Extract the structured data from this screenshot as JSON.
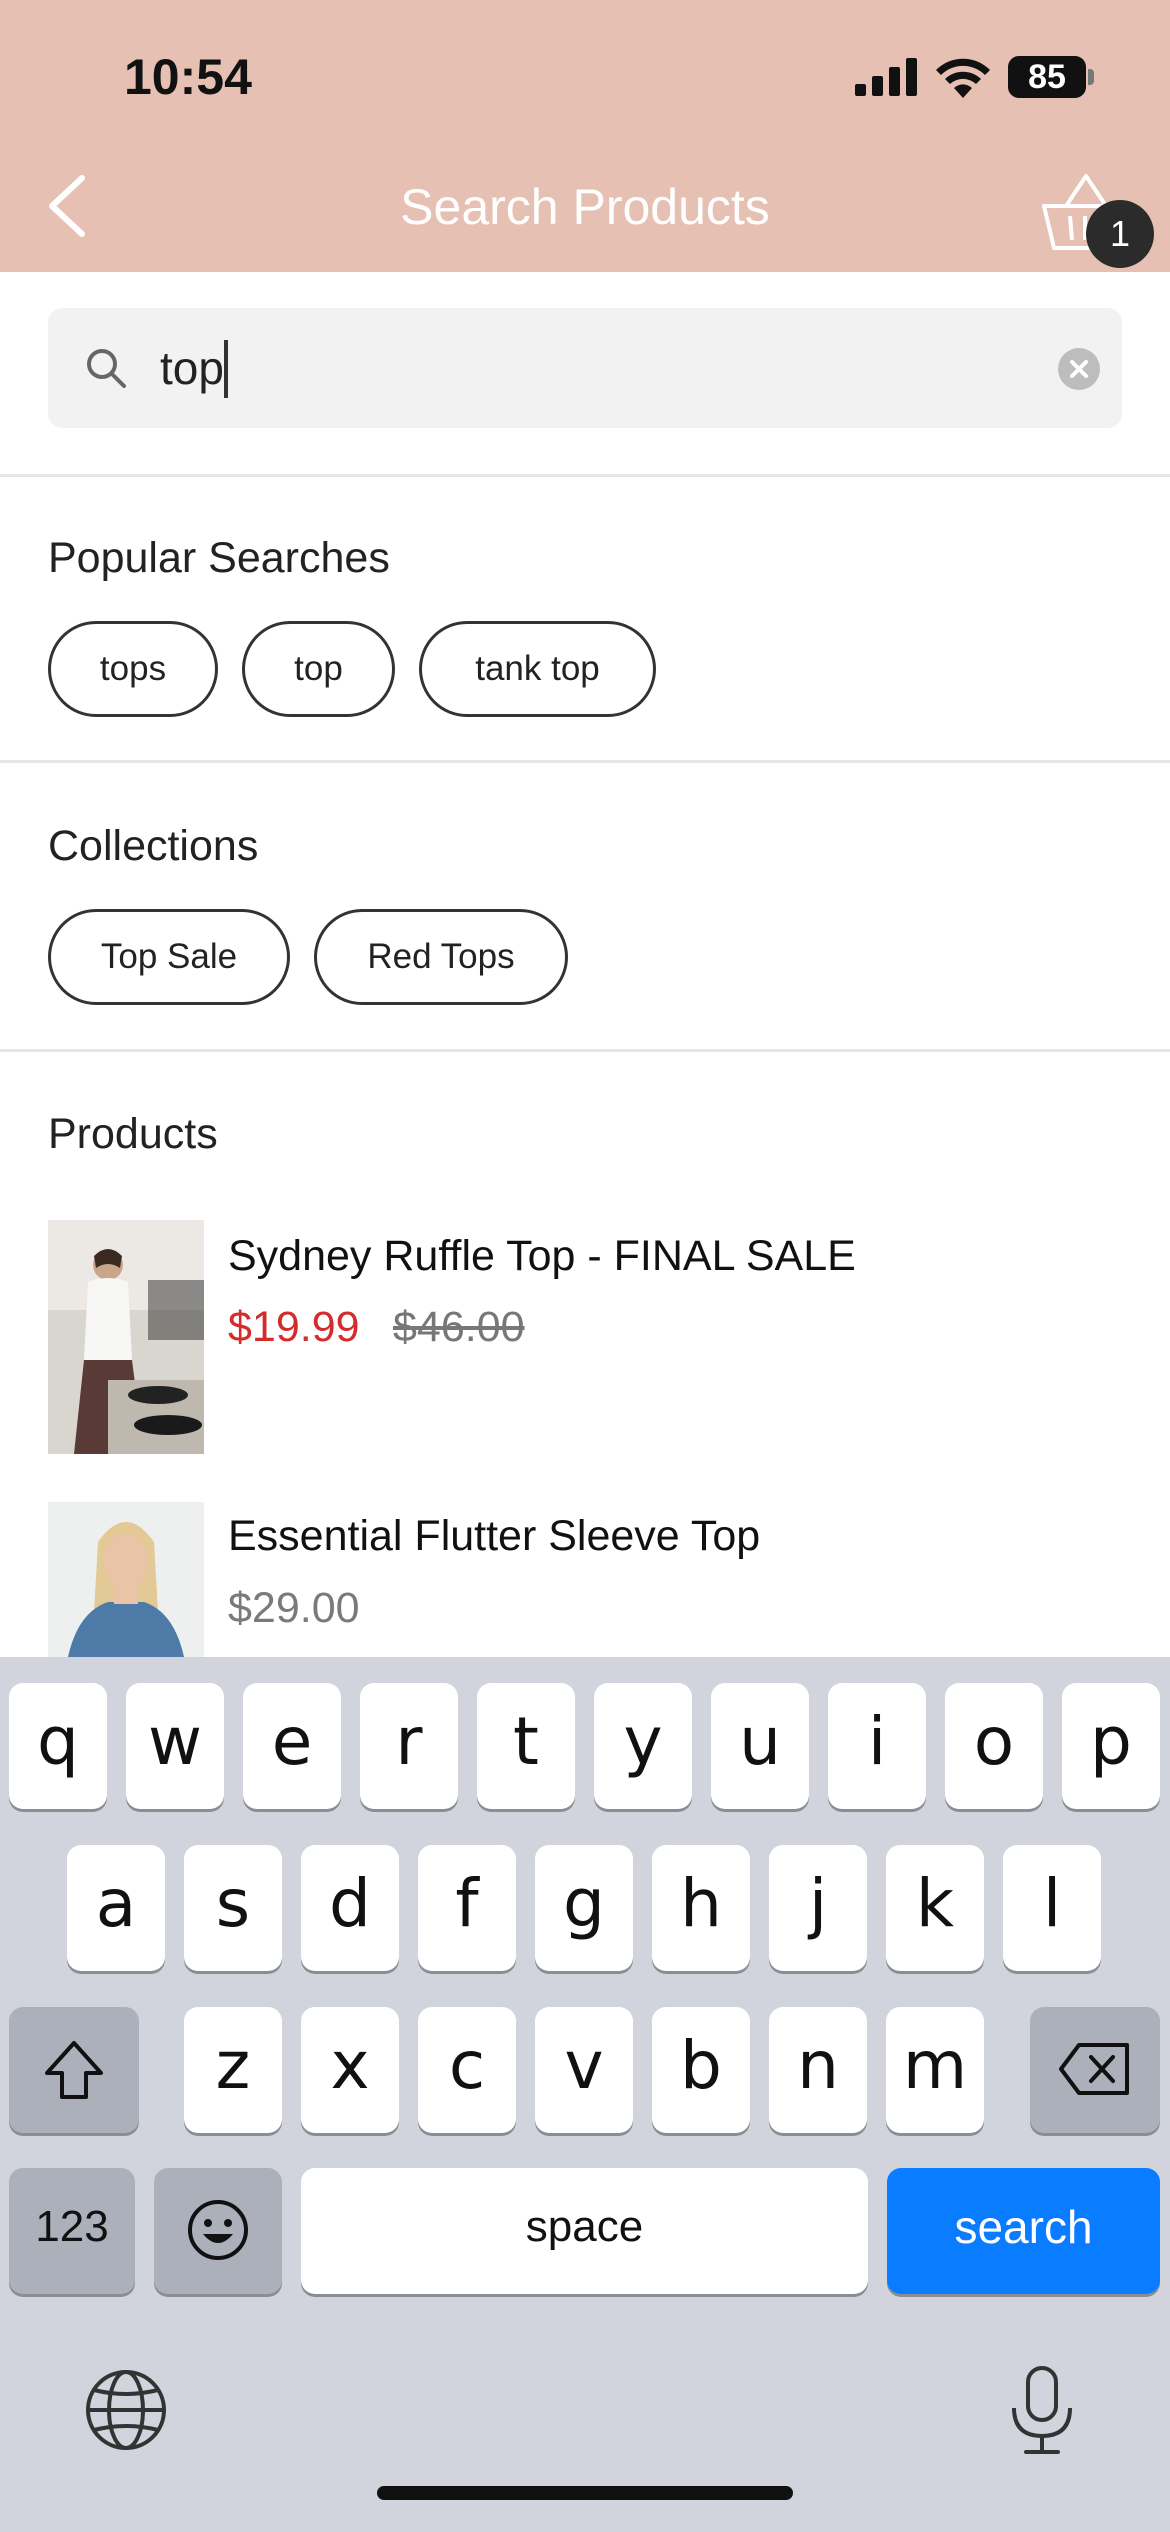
{
  "status_bar": {
    "time": "10:54",
    "battery": "85"
  },
  "header": {
    "title": "Search Products",
    "cart_count": "1"
  },
  "search": {
    "value": "top",
    "placeholder": ""
  },
  "popular": {
    "title": "Popular Searches",
    "chips": [
      "tops",
      "top",
      "tank top"
    ]
  },
  "collections": {
    "title": "Collections",
    "chips": [
      "Top Sale",
      "Red Tops"
    ]
  },
  "products": {
    "title": "Products",
    "items": [
      {
        "name": "Sydney Ruffle Top - FINAL SALE",
        "sale_price": "$19.99",
        "original_price": "$46.00"
      },
      {
        "name": "Essential Flutter Sleeve Top",
        "price": "$29.00"
      }
    ]
  },
  "keyboard": {
    "row1": [
      "q",
      "w",
      "e",
      "r",
      "t",
      "y",
      "u",
      "i",
      "o",
      "p"
    ],
    "row2": [
      "a",
      "s",
      "d",
      "f",
      "g",
      "h",
      "j",
      "k",
      "l"
    ],
    "row3": [
      "z",
      "x",
      "c",
      "v",
      "b",
      "n",
      "m"
    ],
    "numbers_label": "123",
    "space_label": "space",
    "action_label": "search"
  },
  "colors": {
    "header_bg": "#e6c0b2",
    "sale_red": "#d42b2b",
    "key_blue": "#0a7cff"
  }
}
